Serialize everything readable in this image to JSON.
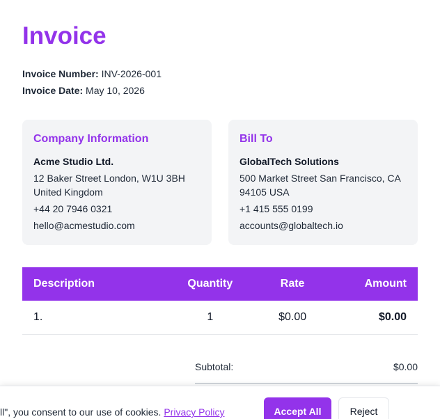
{
  "invoice": {
    "title": "Invoice",
    "number_label": "Invoice Number:",
    "number_value": "INV-2026-001",
    "date_label": "Invoice Date:",
    "date_value": "May 10, 2026"
  },
  "company": {
    "heading": "Company Information",
    "name": "Acme Studio Ltd.",
    "address_line1": "12 Baker Street London, W1U 3BH",
    "address_line2": "United Kingdom",
    "phone": "+44 20 7946 0321",
    "email": "hello@acmestudio.com"
  },
  "bill_to": {
    "heading": "Bill To",
    "name": "GlobalTech Solutions",
    "address_line1": "500 Market Street San Francisco, CA",
    "address_line2": "94105 USA",
    "phone": "+1 415 555 0199",
    "email": "accounts@globaltech.io"
  },
  "items_table": {
    "headers": [
      "Description",
      "Quantity",
      "Rate",
      "Amount"
    ],
    "rows": [
      [
        "1.",
        "1",
        "$0.00",
        "$0.00"
      ]
    ]
  },
  "totals": {
    "subtotal_label": "Subtotal:",
    "subtotal_value": "$0.00"
  },
  "cookie_banner": {
    "text": "ll\", you consent to our use of cookies. ",
    "link": "Privacy Policy",
    "accept_label": "Accept All",
    "reject_label": "Reject"
  },
  "colors": {
    "accent": "#9333ea",
    "card_bg": "#f3f4f6"
  }
}
